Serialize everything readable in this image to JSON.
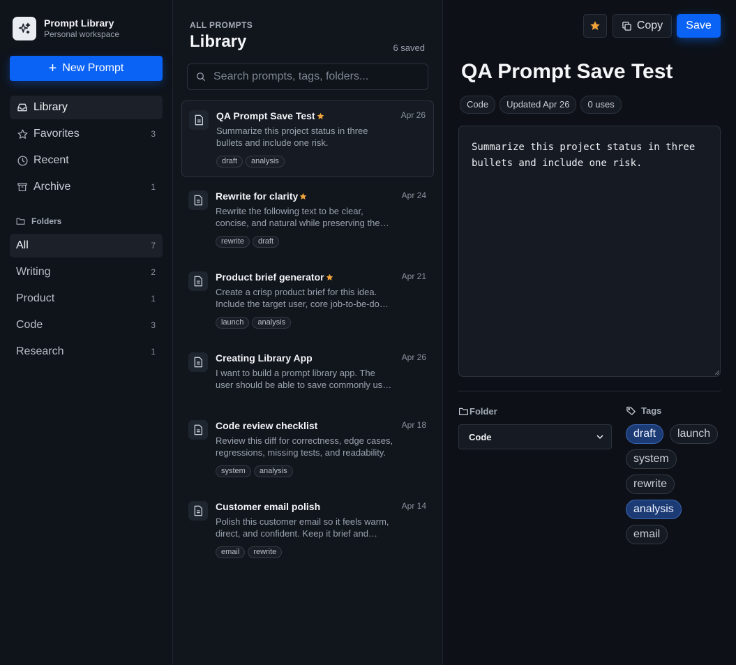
{
  "brand": {
    "name": "Prompt Library",
    "subtitle": "Personal workspace"
  },
  "new_prompt_label": "New Prompt",
  "nav": [
    {
      "label": "Library",
      "count": "",
      "icon": "inbox-icon"
    },
    {
      "label": "Favorites",
      "count": "3",
      "icon": "star-icon"
    },
    {
      "label": "Recent",
      "count": "",
      "icon": "clock-icon"
    },
    {
      "label": "Archive",
      "count": "1",
      "icon": "archive-icon"
    }
  ],
  "folders_heading": "Folders",
  "folders": [
    {
      "label": "All",
      "count": "7"
    },
    {
      "label": "Writing",
      "count": "2"
    },
    {
      "label": "Product",
      "count": "1"
    },
    {
      "label": "Code",
      "count": "3"
    },
    {
      "label": "Research",
      "count": "1"
    }
  ],
  "list": {
    "kicker": "ALL PROMPTS",
    "title": "Library",
    "count": "6 saved",
    "search_placeholder": "Search prompts, tags, folders..."
  },
  "prompts": [
    {
      "title": "QA Prompt Save Test",
      "favorite": true,
      "date": "Apr 26",
      "desc": "Summarize this project status in three bullets and include one risk.",
      "tags": [
        "draft",
        "analysis"
      ]
    },
    {
      "title": "Rewrite for clarity",
      "favorite": true,
      "date": "Apr 24",
      "desc": "Rewrite the following text to be clear, concise, and natural while preserving the original meaning.",
      "tags": [
        "rewrite",
        "draft"
      ]
    },
    {
      "title": "Product brief generator",
      "favorite": true,
      "date": "Apr 21",
      "desc": "Create a crisp product brief for this idea. Include the target user, core job-to-be-done, and success metrics.",
      "tags": [
        "launch",
        "analysis"
      ]
    },
    {
      "title": "Creating Library App",
      "favorite": false,
      "date": "Apr 26",
      "desc": "I want to build a prompt library app. The user should be able to save commonly used prompts.",
      "tags": []
    },
    {
      "title": "Code review checklist",
      "favorite": false,
      "date": "Apr 18",
      "desc": "Review this diff for correctness, edge cases, regressions, missing tests, and readability.",
      "tags": [
        "system",
        "analysis"
      ]
    },
    {
      "title": "Customer email polish",
      "favorite": false,
      "date": "Apr 14",
      "desc": "Polish this customer email so it feels warm, direct, and confident. Keep it brief and friendly.",
      "tags": [
        "email",
        "rewrite"
      ]
    }
  ],
  "detail": {
    "copy_label": "Copy",
    "save_label": "Save",
    "title": "QA Prompt Save Test",
    "meta": [
      "Code",
      "Updated Apr 26",
      "0 uses"
    ],
    "body": "Summarize this project status in three\nbullets and include one risk.",
    "folder_label": "Folder",
    "folder_value": "Code",
    "tags_label": "Tags",
    "tags": [
      {
        "label": "draft",
        "selected": true
      },
      {
        "label": "launch",
        "selected": false
      },
      {
        "label": "system",
        "selected": false
      },
      {
        "label": "rewrite",
        "selected": false
      },
      {
        "label": "analysis",
        "selected": true
      },
      {
        "label": "email",
        "selected": false
      }
    ]
  },
  "colors": {
    "accent": "#0b63f6",
    "favorite_star": "#f0a33a",
    "selected_tag": "#1c3a73"
  }
}
